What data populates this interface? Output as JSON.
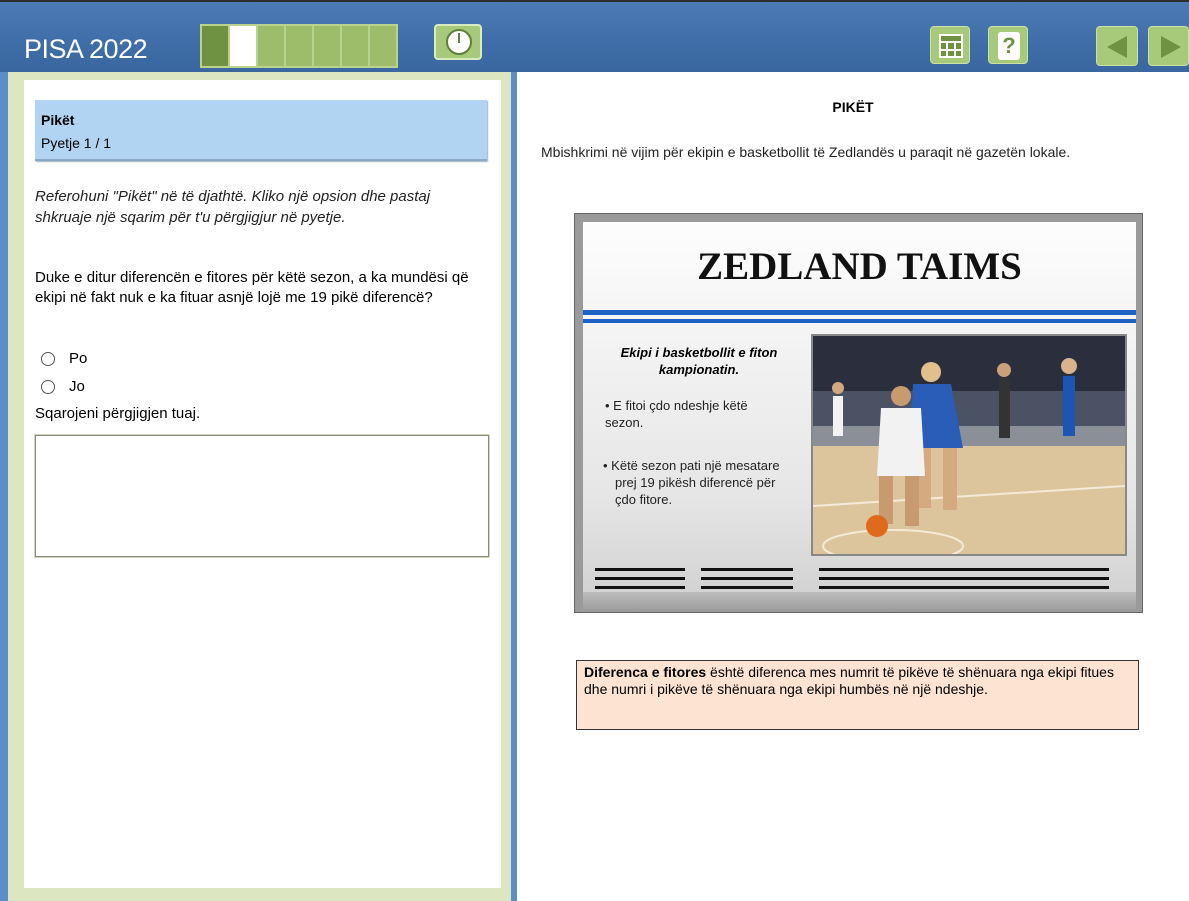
{
  "header": {
    "app_title": "PISA 2022",
    "progress": {
      "total_segments": 7,
      "current_segment": 2
    },
    "tools": [
      "calculator-icon",
      "help-icon",
      "previous-arrow-icon",
      "next-arrow-icon",
      "timer-icon"
    ]
  },
  "question_panel": {
    "unit_title": "Pikët",
    "question_counter": "Pyetje 1 / 1",
    "instructions": "Referohuni \"Pikët\" në të djathtë. Kliko një opsion dhe pastaj shkruaje një sqarim për t'u përgjigjur në pyetje.",
    "question": "Duke e ditur diferencën e fitores për këtë sezon, a ka mundësi që ekipi në fakt nuk e ka fituar asnjë lojë me 19 pikë diferencë?",
    "options": [
      {
        "label": "Po"
      },
      {
        "label": "Jo"
      }
    ],
    "explain_prompt": "Sqarojeni përgjigjen tuaj.",
    "answer_value": ""
  },
  "stimulus_panel": {
    "title": "PIKËT",
    "intro": "Mbishkrimi në vijim për ekipin e basketbollit të Zedlandës u paraqit në gazetën lokale.",
    "newspaper": {
      "masthead": "ZEDLAND TAIMS",
      "headline": "Ekipi i basketbollit e fiton kampionatin.",
      "bullets": [
        "E fitoi çdo ndeshje këtë sezon.",
        "Këtë sezon pati një mesatare prej 19 pikësh diferencë për çdo fitore."
      ]
    },
    "definition_term": "Diferenca e fitores",
    "definition_text": " është diferenca mes numrit të pikëve të shënuara nga ekipi fitues dhe numri i pikëve të shënuara nga ekipi humbës në një ndeshje."
  },
  "colors": {
    "header_blue": "#3f6ea8",
    "tool_green": "#a7c97a",
    "question_header_blue": "#b0d4f1",
    "definition_bg": "#fde3d2",
    "masthead_rule_blue": "#1d63c5"
  }
}
